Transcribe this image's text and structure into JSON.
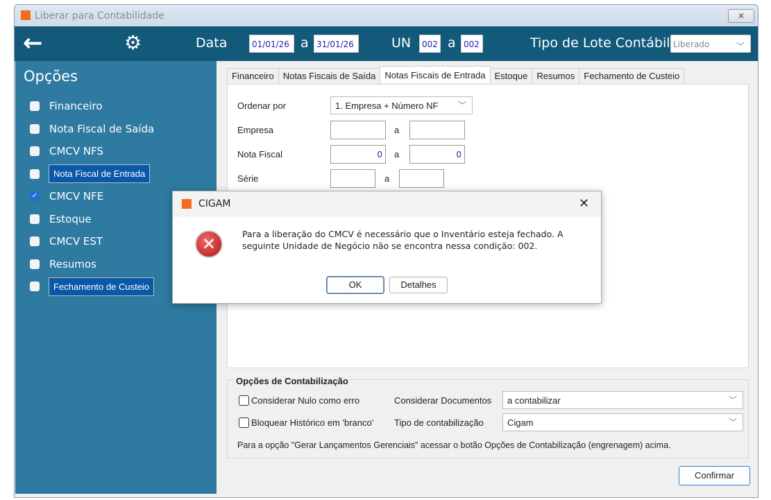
{
  "window": {
    "title": "Liberar para Contabilidade",
    "close": "✕",
    "logo": "CG"
  },
  "header": {
    "data_label": "Data",
    "date_from": "01/01/26",
    "a1": "a",
    "date_to": "31/01/26",
    "un_label": "UN",
    "un_from": "002",
    "a2": "a",
    "un_to": "002",
    "tipo_label": "Tipo de Lote Contábil",
    "tipo_value": "Liberado"
  },
  "sidebar": {
    "title": "Opções",
    "items": [
      {
        "label": "Financeiro",
        "checked": false
      },
      {
        "label": "Nota Fiscal de Saída",
        "checked": false
      },
      {
        "label": "CMCV NFS",
        "checked": false
      },
      {
        "label": "Nota Fiscal de Entrada",
        "checked": false
      },
      {
        "label": "CMCV NFE",
        "checked": true
      },
      {
        "label": "Estoque",
        "checked": false
      },
      {
        "label": "CMCV EST",
        "checked": false
      },
      {
        "label": "Resumos",
        "checked": false
      },
      {
        "label": "Fechamento de Custeio",
        "checked": false
      }
    ]
  },
  "tabs": [
    "Financeiro",
    "Notas Fiscais de Saída",
    "Notas Fiscais de Entrada",
    "Estoque",
    "Resumos",
    "Fechamento de Custeio"
  ],
  "form": {
    "ordenar_label": "Ordenar por",
    "ordenar_value": "1. Empresa + Número NF",
    "empresa_label": "Empresa",
    "nota_label": "Nota Fiscal",
    "nota_from": "0",
    "nota_to": "0",
    "serie_label": "Série",
    "a": "a"
  },
  "options": {
    "title": "Opções de Contabilização",
    "nulo": "Considerar Nulo como erro",
    "bloquear": "Bloquear Histórico em 'branco'",
    "docs_label": "Considerar Documentos",
    "docs_value": "a contabilizar",
    "tipo_label": "Tipo de contabilização",
    "tipo_value": "Cigam",
    "note": "Para a opção \"Gerar Lançamentos Gerenciais\" acessar o botão Opções de Contabilização (engrenagem) acima."
  },
  "confirm": "Confirmar",
  "dialog": {
    "title": "CIGAM",
    "message1": "Para a liberação do CMCV é necessário que o Inventário esteja fechado. A",
    "message2": "seguinte Unidade de Negócio não se encontra nessa condição: 002.",
    "ok": "OK",
    "details": "Detalhes",
    "close": "✕"
  }
}
